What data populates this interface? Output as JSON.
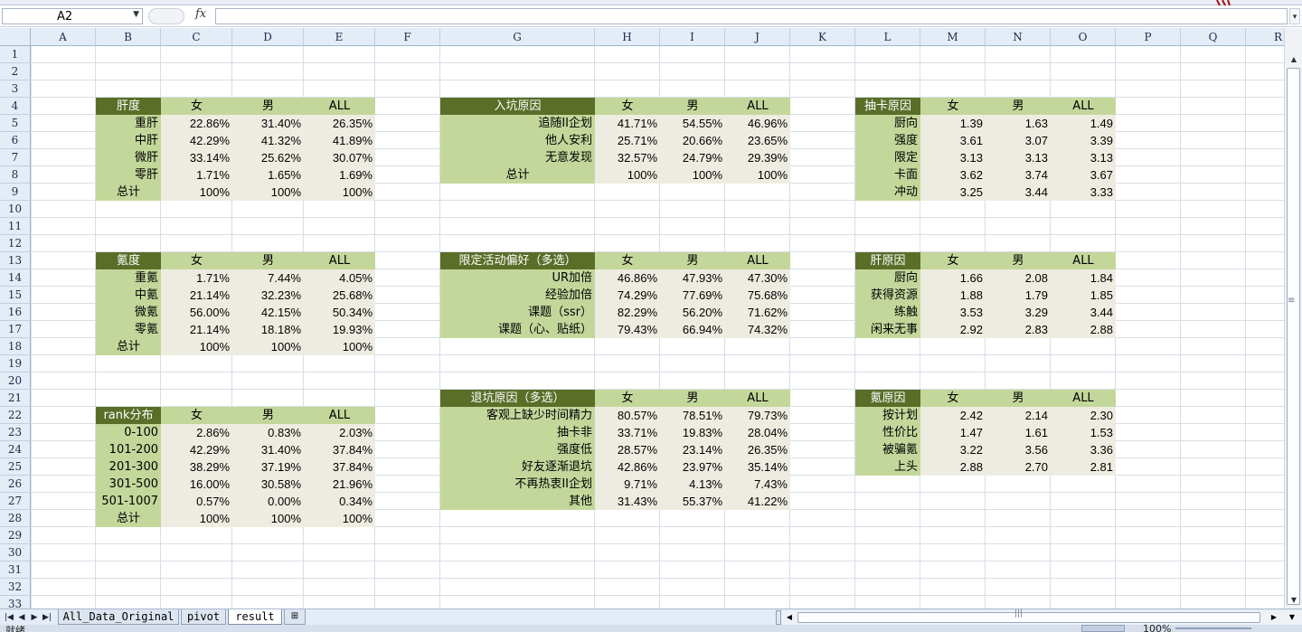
{
  "formula_bar": {
    "name_box": "A2",
    "fx_label": "fx",
    "formula": ""
  },
  "columns": [
    "A",
    "B",
    "C",
    "D",
    "E",
    "F",
    "G",
    "H",
    "I",
    "J",
    "K",
    "L",
    "M",
    "N",
    "O",
    "P",
    "Q",
    "R"
  ],
  "rows": [
    "1",
    "2",
    "3",
    "4",
    "5",
    "6",
    "7",
    "8",
    "9",
    "10",
    "11",
    "12",
    "13",
    "14",
    "15",
    "16",
    "17",
    "18",
    "19",
    "20",
    "21",
    "22",
    "23",
    "24",
    "25",
    "26",
    "27",
    "28",
    "29",
    "30",
    "31",
    "32",
    "33"
  ],
  "tables": {
    "gandu": {
      "headers": [
        "肝度",
        "女",
        "男",
        "ALL"
      ],
      "rows": [
        [
          "重肝",
          "22.86%",
          "31.40%",
          "26.35%"
        ],
        [
          "中肝",
          "42.29%",
          "41.32%",
          "41.89%"
        ],
        [
          "微肝",
          "33.14%",
          "25.62%",
          "30.07%"
        ],
        [
          "零肝",
          "1.71%",
          "1.65%",
          "1.69%"
        ],
        [
          "总计",
          "100%",
          "100%",
          "100%"
        ]
      ]
    },
    "kedu": {
      "headers": [
        "氪度",
        "女",
        "男",
        "ALL"
      ],
      "rows": [
        [
          "重氪",
          "1.71%",
          "7.44%",
          "4.05%"
        ],
        [
          "中氪",
          "21.14%",
          "32.23%",
          "25.68%"
        ],
        [
          "微氪",
          "56.00%",
          "42.15%",
          "50.34%"
        ],
        [
          "零氪",
          "21.14%",
          "18.18%",
          "19.93%"
        ],
        [
          "总计",
          "100%",
          "100%",
          "100%"
        ]
      ]
    },
    "rank": {
      "headers": [
        "rank分布",
        "女",
        "男",
        "ALL"
      ],
      "rows": [
        [
          "0-100",
          "2.86%",
          "0.83%",
          "2.03%"
        ],
        [
          "101-200",
          "42.29%",
          "31.40%",
          "37.84%"
        ],
        [
          "201-300",
          "38.29%",
          "37.19%",
          "37.84%"
        ],
        [
          "301-500",
          "16.00%",
          "30.58%",
          "21.96%"
        ],
        [
          "501-1007",
          "0.57%",
          "0.00%",
          "0.34%"
        ],
        [
          "总计",
          "100%",
          "100%",
          "100%"
        ]
      ]
    },
    "rukeng": {
      "headers": [
        "入坑原因",
        "女",
        "男",
        "ALL"
      ],
      "rows": [
        [
          "追随II企划",
          "41.71%",
          "54.55%",
          "46.96%"
        ],
        [
          "他人安利",
          "25.71%",
          "20.66%",
          "23.65%"
        ],
        [
          "无意发现",
          "32.57%",
          "24.79%",
          "29.39%"
        ],
        [
          "总计",
          "100%",
          "100%",
          "100%"
        ]
      ]
    },
    "xianding": {
      "headers": [
        "限定活动偏好（多选）",
        "女",
        "男",
        "ALL"
      ],
      "rows": [
        [
          "UR加倍",
          "46.86%",
          "47.93%",
          "47.30%"
        ],
        [
          "经验加倍",
          "74.29%",
          "77.69%",
          "75.68%"
        ],
        [
          "课题（ssr）",
          "82.29%",
          "56.20%",
          "71.62%"
        ],
        [
          "课题（心、贴纸）",
          "79.43%",
          "66.94%",
          "74.32%"
        ]
      ]
    },
    "tuikeng": {
      "headers": [
        "退坑原因（多选）",
        "女",
        "男",
        "ALL"
      ],
      "rows": [
        [
          "客观上缺少时间精力",
          "80.57%",
          "78.51%",
          "79.73%"
        ],
        [
          "抽卡非",
          "33.71%",
          "19.83%",
          "28.04%"
        ],
        [
          "强度低",
          "28.57%",
          "23.14%",
          "26.35%"
        ],
        [
          "好友逐渐退坑",
          "42.86%",
          "23.97%",
          "35.14%"
        ],
        [
          "不再热衷II企划",
          "9.71%",
          "4.13%",
          "7.43%"
        ],
        [
          "其他",
          "31.43%",
          "55.37%",
          "41.22%"
        ]
      ]
    },
    "chouka": {
      "headers": [
        "抽卡原因",
        "女",
        "男",
        "ALL"
      ],
      "rows": [
        [
          "厨向",
          "1.39",
          "1.63",
          "1.49"
        ],
        [
          "强度",
          "3.61",
          "3.07",
          "3.39"
        ],
        [
          "限定",
          "3.13",
          "3.13",
          "3.13"
        ],
        [
          "卡面",
          "3.62",
          "3.74",
          "3.67"
        ],
        [
          "冲动",
          "3.25",
          "3.44",
          "3.33"
        ]
      ]
    },
    "ganyuanyin": {
      "headers": [
        "肝原因",
        "女",
        "男",
        "ALL"
      ],
      "rows": [
        [
          "厨向",
          "1.66",
          "2.08",
          "1.84"
        ],
        [
          "获得资源",
          "1.88",
          "1.79",
          "1.85"
        ],
        [
          "练触",
          "3.53",
          "3.29",
          "3.44"
        ],
        [
          "闲来无事",
          "2.92",
          "2.83",
          "2.88"
        ]
      ]
    },
    "keyuanyin": {
      "headers": [
        "氪原因",
        "女",
        "男",
        "ALL"
      ],
      "rows": [
        [
          "按计划",
          "2.42",
          "2.14",
          "2.30"
        ],
        [
          "性价比",
          "1.47",
          "1.61",
          "1.53"
        ],
        [
          "被骗氪",
          "3.22",
          "3.56",
          "3.36"
        ],
        [
          "上头",
          "2.88",
          "2.70",
          "2.81"
        ]
      ]
    }
  },
  "sheet_tabs": [
    "All_Data_Original",
    "pivot",
    "result"
  ],
  "active_tab": "result",
  "status": {
    "ready": "就绪",
    "zoom": "100%"
  }
}
